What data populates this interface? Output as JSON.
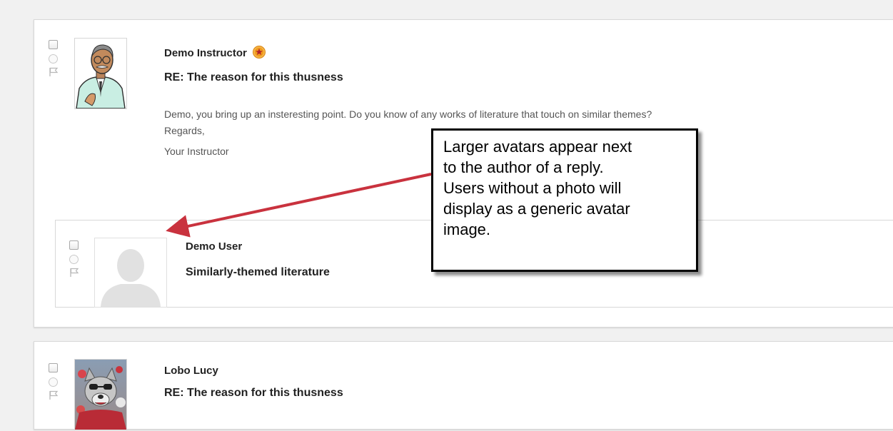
{
  "posts": [
    {
      "author": "Demo Instructor",
      "subject": "RE: The reason for this thusness",
      "body": [
        "Demo, you bring up an insteresting point.  Do you know of any works of literature that touch on similar themes?",
        "Regards,",
        "Your Instructor"
      ],
      "reply": {
        "author": "Demo User",
        "subject": "Similarly-themed literature"
      }
    },
    {
      "author": "Lobo Lucy",
      "subject": "RE: The reason for this thusness"
    }
  ],
  "callout": {
    "lines": [
      "Larger avatars appear next",
      "to the author of a reply.",
      "Users without a photo will",
      "display as a generic avatar",
      "image."
    ]
  },
  "colors": {
    "arrow": "#c9323e",
    "badge": "#f09a1c",
    "page_background": "#f1f1f1"
  },
  "icons": {
    "select": "checkbox-icon",
    "unread": "radio-icon",
    "flag": "flag-icon",
    "instructor_badge": "instructor-star-badge-icon"
  }
}
